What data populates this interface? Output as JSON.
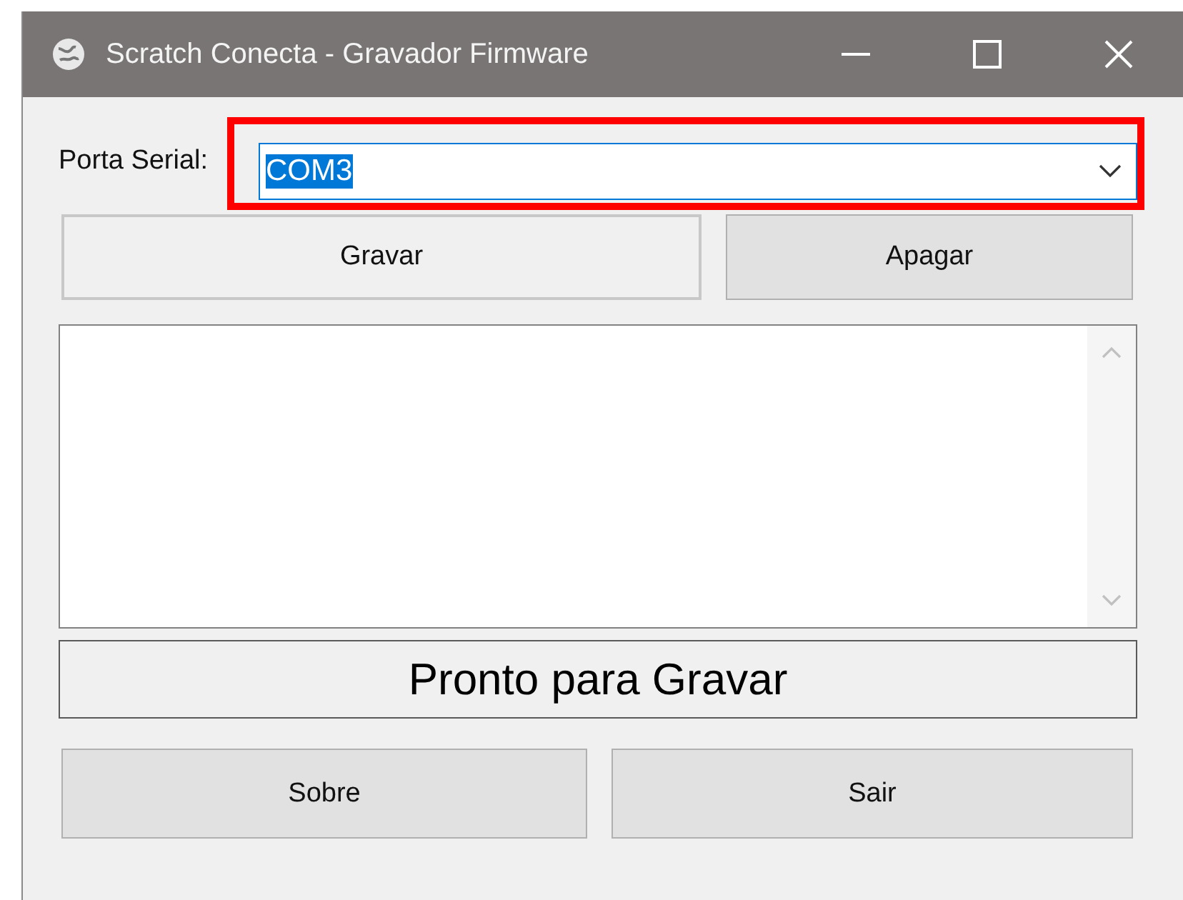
{
  "window": {
    "title": "Scratch Conecta - Gravador Firmware"
  },
  "serial_port": {
    "label": "Porta Serial:",
    "value": "COM3",
    "text_selected": true,
    "highlighted": true
  },
  "action_buttons": [
    {
      "label": "Gravar",
      "focused": true
    },
    {
      "label": "Apagar",
      "focused": false
    }
  ],
  "status": "Pronto para Gravar",
  "footer_buttons": [
    {
      "label": "Sobre",
      "focused": false
    },
    {
      "label": "Sair",
      "focused": false
    }
  ]
}
